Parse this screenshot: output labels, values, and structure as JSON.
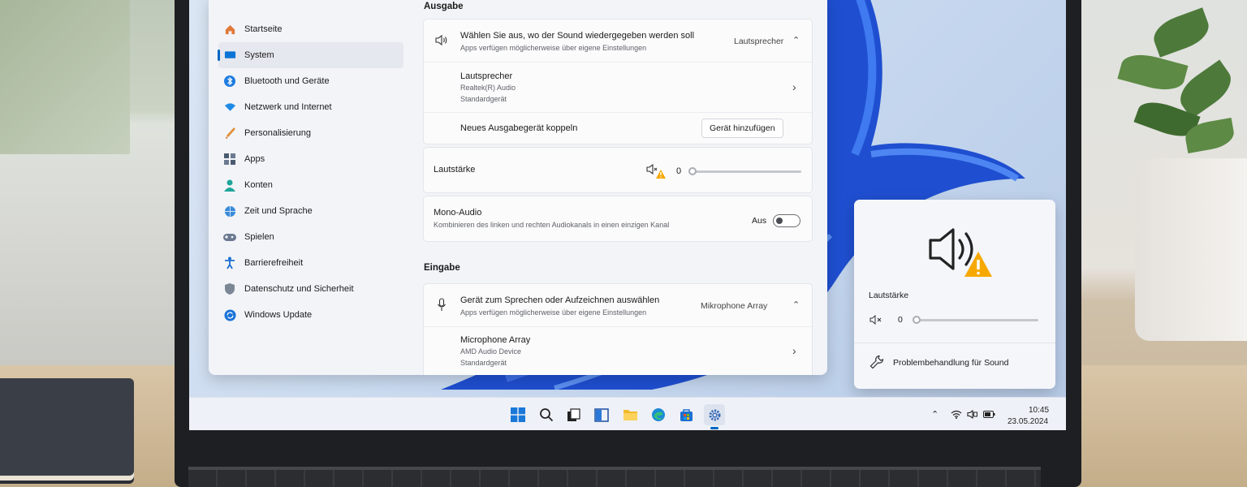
{
  "nav": {
    "items": [
      {
        "label": "Startseite",
        "icon": "home-icon"
      },
      {
        "label": "System",
        "icon": "system-icon",
        "active": true
      },
      {
        "label": "Bluetooth und Geräte",
        "icon": "bluetooth-icon"
      },
      {
        "label": "Netzwerk und Internet",
        "icon": "network-icon"
      },
      {
        "label": "Personalisierung",
        "icon": "brush-icon"
      },
      {
        "label": "Apps",
        "icon": "apps-icon"
      },
      {
        "label": "Konten",
        "icon": "account-icon"
      },
      {
        "label": "Zeit und Sprache",
        "icon": "globe-icon"
      },
      {
        "label": "Spielen",
        "icon": "gamepad-icon"
      },
      {
        "label": "Barrierefreiheit",
        "icon": "accessibility-icon"
      },
      {
        "label": "Datenschutz und Sicherheit",
        "icon": "shield-icon"
      },
      {
        "label": "Windows Update",
        "icon": "update-icon"
      }
    ]
  },
  "output": {
    "heading": "Ausgabe",
    "select_title": "Wählen Sie aus, wo der Sound wiedergegeben werden soll",
    "select_subtitle": "Apps verfügen möglicherweise über eigene Einstellungen",
    "select_value": "Lautsprecher",
    "device_name": "Lautsprecher",
    "device_driver": "Realtek(R) Audio",
    "device_default": "Standardgerät",
    "pair_label": "Neues Ausgabegerät koppeln",
    "pair_button": "Gerät hinzufügen",
    "volume_label": "Lautstärke",
    "volume_value": "0",
    "mono_title": "Mono-Audio",
    "mono_subtitle": "Kombinieren des linken und rechten Audiokanals in einen einzigen Kanal",
    "mono_state": "Aus"
  },
  "input": {
    "heading": "Eingabe",
    "select_title": "Gerät zum Sprechen oder Aufzeichnen auswählen",
    "select_subtitle": "Apps verfügen möglicherweise über eigene Einstellungen",
    "select_value": "Mikrophone Array",
    "device_name": "Microphone Array",
    "device_driver": "AMD Audio Device",
    "device_default": "Standardgerät"
  },
  "flyout": {
    "volume_label": "Lautstärke",
    "volume_value": "0",
    "troubleshoot_label": "Problembehandlung für Sound"
  },
  "taskbar": {
    "time": "10:45",
    "date": "23.05.2024",
    "apps": [
      "start-icon",
      "search-icon",
      "task-view-icon",
      "widgets-icon",
      "file-explorer-icon",
      "edge-icon",
      "store-icon",
      "settings-icon"
    ]
  },
  "colors": {
    "accent": "#0067c0",
    "warning": "#f7a800",
    "win_blue": "#1f4fd0"
  }
}
